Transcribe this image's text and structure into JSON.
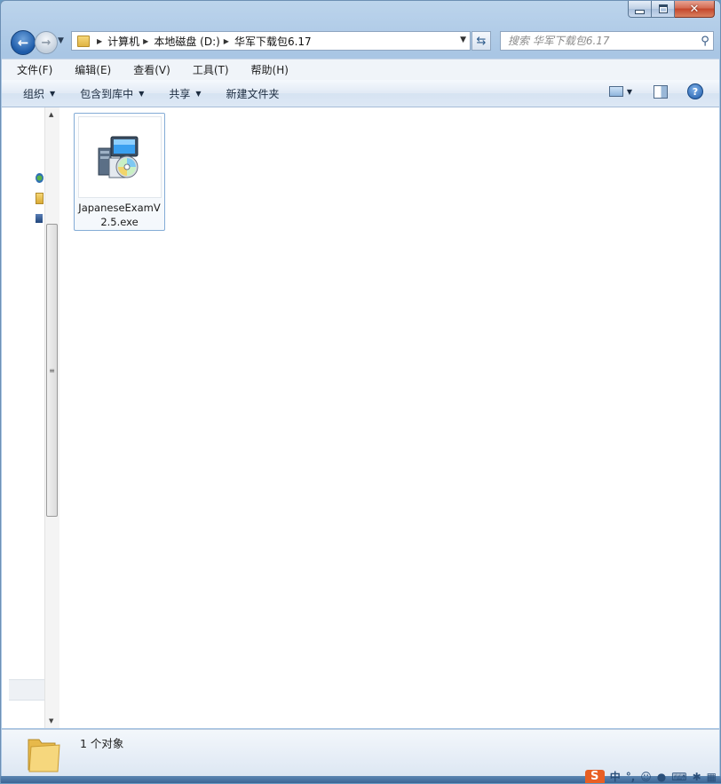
{
  "window": {
    "caption_min": "",
    "caption_max": "",
    "caption_close": "✕"
  },
  "navigation": {
    "breadcrumbs": [
      "计算机",
      "本地磁盘 (D:)",
      "华军下载包6.17"
    ],
    "search_placeholder": "搜索 华军下载包6.17"
  },
  "menubar": {
    "items": [
      "文件(F)",
      "编辑(E)",
      "查看(V)",
      "工具(T)",
      "帮助(H)"
    ]
  },
  "commandbar": {
    "items": [
      "组织",
      "包含到库中",
      "共享",
      "新建文件夹"
    ]
  },
  "files": [
    {
      "name": "JapaneseExamV2.5.exe",
      "icon": "installer-icon"
    }
  ],
  "details": {
    "count_text": "1 个对象"
  },
  "tray": {
    "ime_logo": "S",
    "ime_mode": "中"
  },
  "icons": {
    "back": "arrow-left-icon",
    "forward": "arrow-right-icon",
    "refresh": "refresh-icon",
    "search": "search-icon",
    "help": "help-icon"
  }
}
